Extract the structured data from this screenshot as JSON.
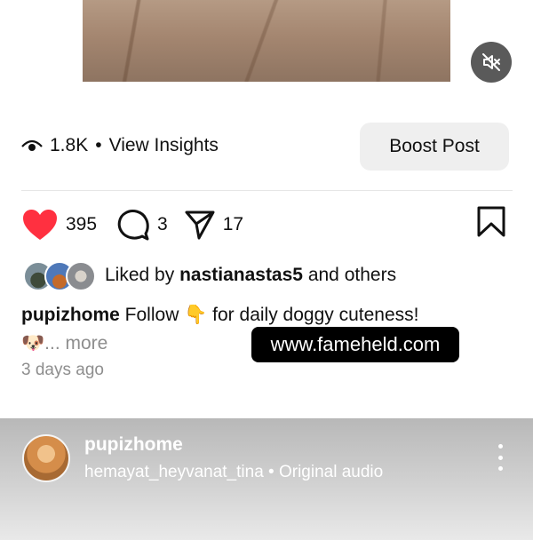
{
  "insights": {
    "views": "1.8K",
    "separator": "•",
    "link_label": "View Insights"
  },
  "boost": {
    "label": "Boost Post"
  },
  "actions": {
    "likes": "395",
    "comments": "3",
    "shares": "17"
  },
  "liked_by": {
    "prefix": "Liked by",
    "user": "nastianastas5",
    "suffix": "and others"
  },
  "caption": {
    "username": "pupizhome",
    "text": "Follow 👇 for daily doggy cuteness!",
    "second_line_emoji": "🐶",
    "more": "... more"
  },
  "posted": "3 days ago",
  "watermark": "www.fameheld.com",
  "audio_sheet": {
    "username": "pupizhome",
    "audio": "hemayat_heyvanat_tina • Original audio"
  },
  "colors": {
    "like_red": "#ff3040",
    "muted_text": "#8e8e8e",
    "boost_bg": "#efefef"
  },
  "icons": [
    "eye-icon",
    "heart-icon",
    "comment-icon",
    "share-icon",
    "bookmark-icon",
    "mute-icon",
    "more-icon"
  ]
}
